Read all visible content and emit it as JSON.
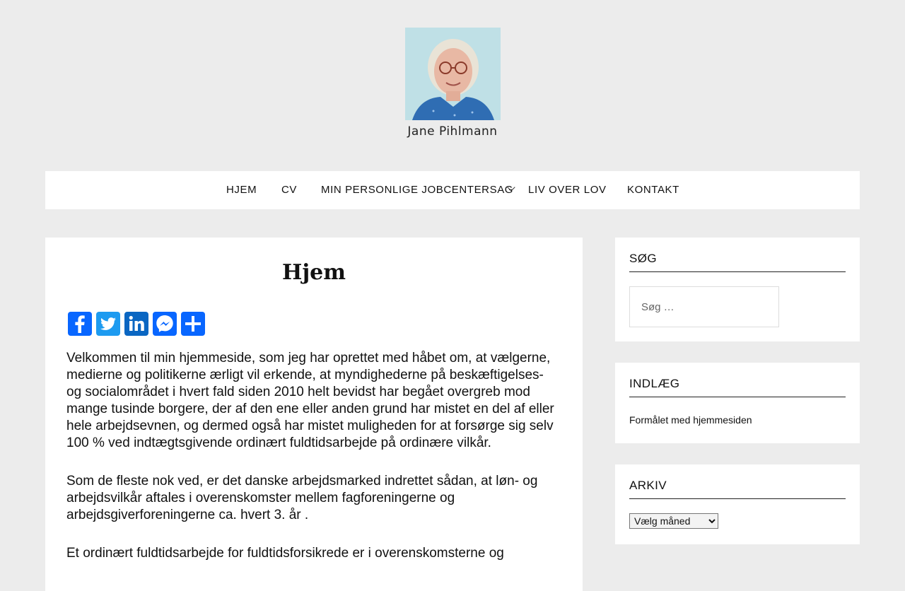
{
  "site": {
    "title": "Jane Pihlmann"
  },
  "nav": {
    "items": [
      {
        "label": "HJEM"
      },
      {
        "label": "CV"
      },
      {
        "label": "MIN PERSONLIGE JOBCENTERSAG"
      },
      {
        "label": "LIV OVER LOV"
      },
      {
        "label": "KONTAKT"
      }
    ]
  },
  "main": {
    "title": "Hjem",
    "share_buttons": [
      {
        "name": "Facebook",
        "color": "#0866ff"
      },
      {
        "name": "Twitter",
        "color": "#1d9bf0"
      },
      {
        "name": "LinkedIn",
        "color": "#0a66c2"
      },
      {
        "name": "Messenger",
        "color": "#0866ff"
      },
      {
        "name": "Share",
        "color": "#0866ff"
      }
    ],
    "paragraphs": [
      "Velkommen til min hjemmeside, som jeg har oprettet med håbet om, at vælgerne, medierne og politikerne ærligt vil erkende, at myndighederne på beskæftigelses- og socialområdet i hvert fald siden 2010 helt bevidst har begået overgreb mod mange tusinde borgere, der af den ene eller anden grund har mistet en del af eller hele arbejdsevnen, og dermed også har mistet muligheden for at forsørge sig selv 100 % ved indtægtsgivende ordinært fuldtidsarbejde på ordinære vilkår.",
      "Som de fleste nok ved, er det danske arbejdsmarked indrettet sådan, at løn- og arbejdsvilkår aftales i overenskomster mellem fagforeningerne og arbejdsgiverforeningerne ca. hvert 3. år .",
      "Et ordinært fuldtidsarbejde for fuldtidsforsikrede er i overenskomsterne og"
    ]
  },
  "sidebar": {
    "search": {
      "title": "SØG",
      "placeholder": "Søg …"
    },
    "posts": {
      "title": "INDLÆG",
      "items": [
        {
          "label": "Formålet med hjemmesiden"
        }
      ]
    },
    "archive": {
      "title": "ARKIV",
      "selected": "Vælg måned"
    }
  }
}
